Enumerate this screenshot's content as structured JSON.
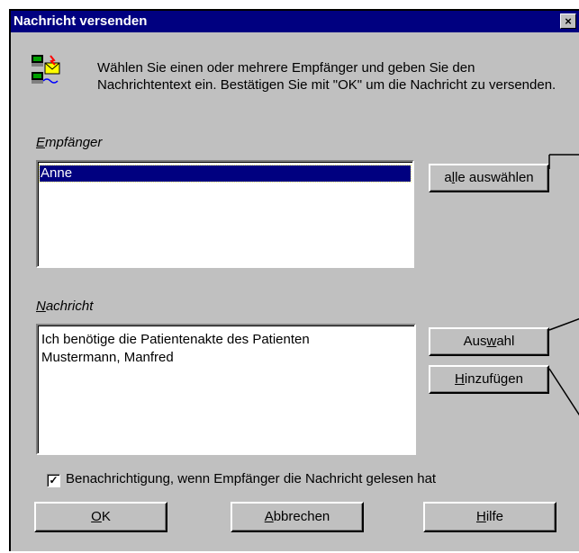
{
  "window": {
    "title": "Nachricht versenden",
    "close_glyph": "×"
  },
  "intro_text": "Wählen Sie einen oder mehrere Empfänger und geben Sie den Nachrichtentext ein. Bestätigen Sie mit \"OK\" um die Nachricht zu versenden.",
  "recipients": {
    "label_first": "E",
    "label_rest": "mpfänger",
    "items": [
      "Anne"
    ],
    "select_all": {
      "pre": "a",
      "acc": "l",
      "post": "le auswählen"
    }
  },
  "message": {
    "label_first": "N",
    "label_rest": "achricht",
    "text_line1": "Ich benötige die Patientenakte des Patienten",
    "text_line2": "Mustermann, Manfred",
    "select_button": {
      "pre": "Aus",
      "acc": "w",
      "post": "ahl"
    },
    "add_button": {
      "pre": "",
      "acc": "H",
      "post": "inzufügen"
    }
  },
  "read_receipt": {
    "checked": true,
    "check_glyph": "✓",
    "label": "Benachrichtigung, wenn Empfänger die Nachricht gelesen hat"
  },
  "footer": {
    "ok": {
      "pre": "",
      "acc": "O",
      "post": "K"
    },
    "cancel": {
      "pre": "",
      "acc": "A",
      "post": "bbrechen"
    },
    "help": {
      "pre": "",
      "acc": "H",
      "post": "ilfe"
    }
  },
  "icons": {
    "app": "message-computers-icon",
    "close": "close-icon",
    "checkbox": "checkmark-icon"
  },
  "colors": {
    "titlebar": "#000080",
    "selection": "#000080",
    "face": "#c0c0c0"
  }
}
